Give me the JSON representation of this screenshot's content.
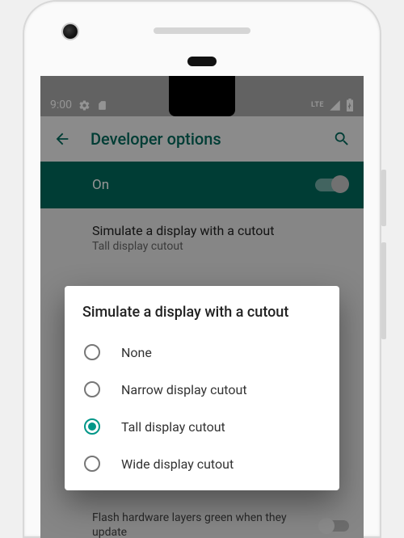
{
  "status": {
    "time": "9:00",
    "lte": "LTE"
  },
  "appbar": {
    "title": "Developer options"
  },
  "toggle": {
    "label": "On"
  },
  "setting": {
    "title": "Simulate a display with a cutout",
    "subtitle": "Tall display cutout"
  },
  "dialog": {
    "title": "Simulate a display with a cutout",
    "options": [
      {
        "label": "None",
        "selected": false
      },
      {
        "label": "Narrow display cutout",
        "selected": false
      },
      {
        "label": "Tall display cutout",
        "selected": true
      },
      {
        "label": "Wide display cutout",
        "selected": false
      }
    ]
  },
  "bg": {
    "flash": "Flash hardware layers green when they update"
  }
}
